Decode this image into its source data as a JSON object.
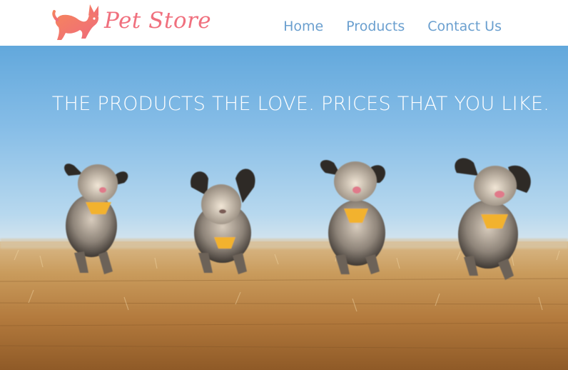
{
  "header": {
    "logo_text": "Pet Store",
    "logo_icon": "puppy-icon",
    "nav": [
      {
        "label": "Home"
      },
      {
        "label": "Products"
      },
      {
        "label": "Contact Us"
      }
    ]
  },
  "hero": {
    "headline": "THE PRODUCTS THE LOVE. PRICES THAT YOU LIKE.",
    "image": "four-dogs-running-in-field"
  },
  "colors": {
    "brand": "#f0707e",
    "nav_link": "#6a9fcf",
    "hero_text": "#ffffff"
  }
}
